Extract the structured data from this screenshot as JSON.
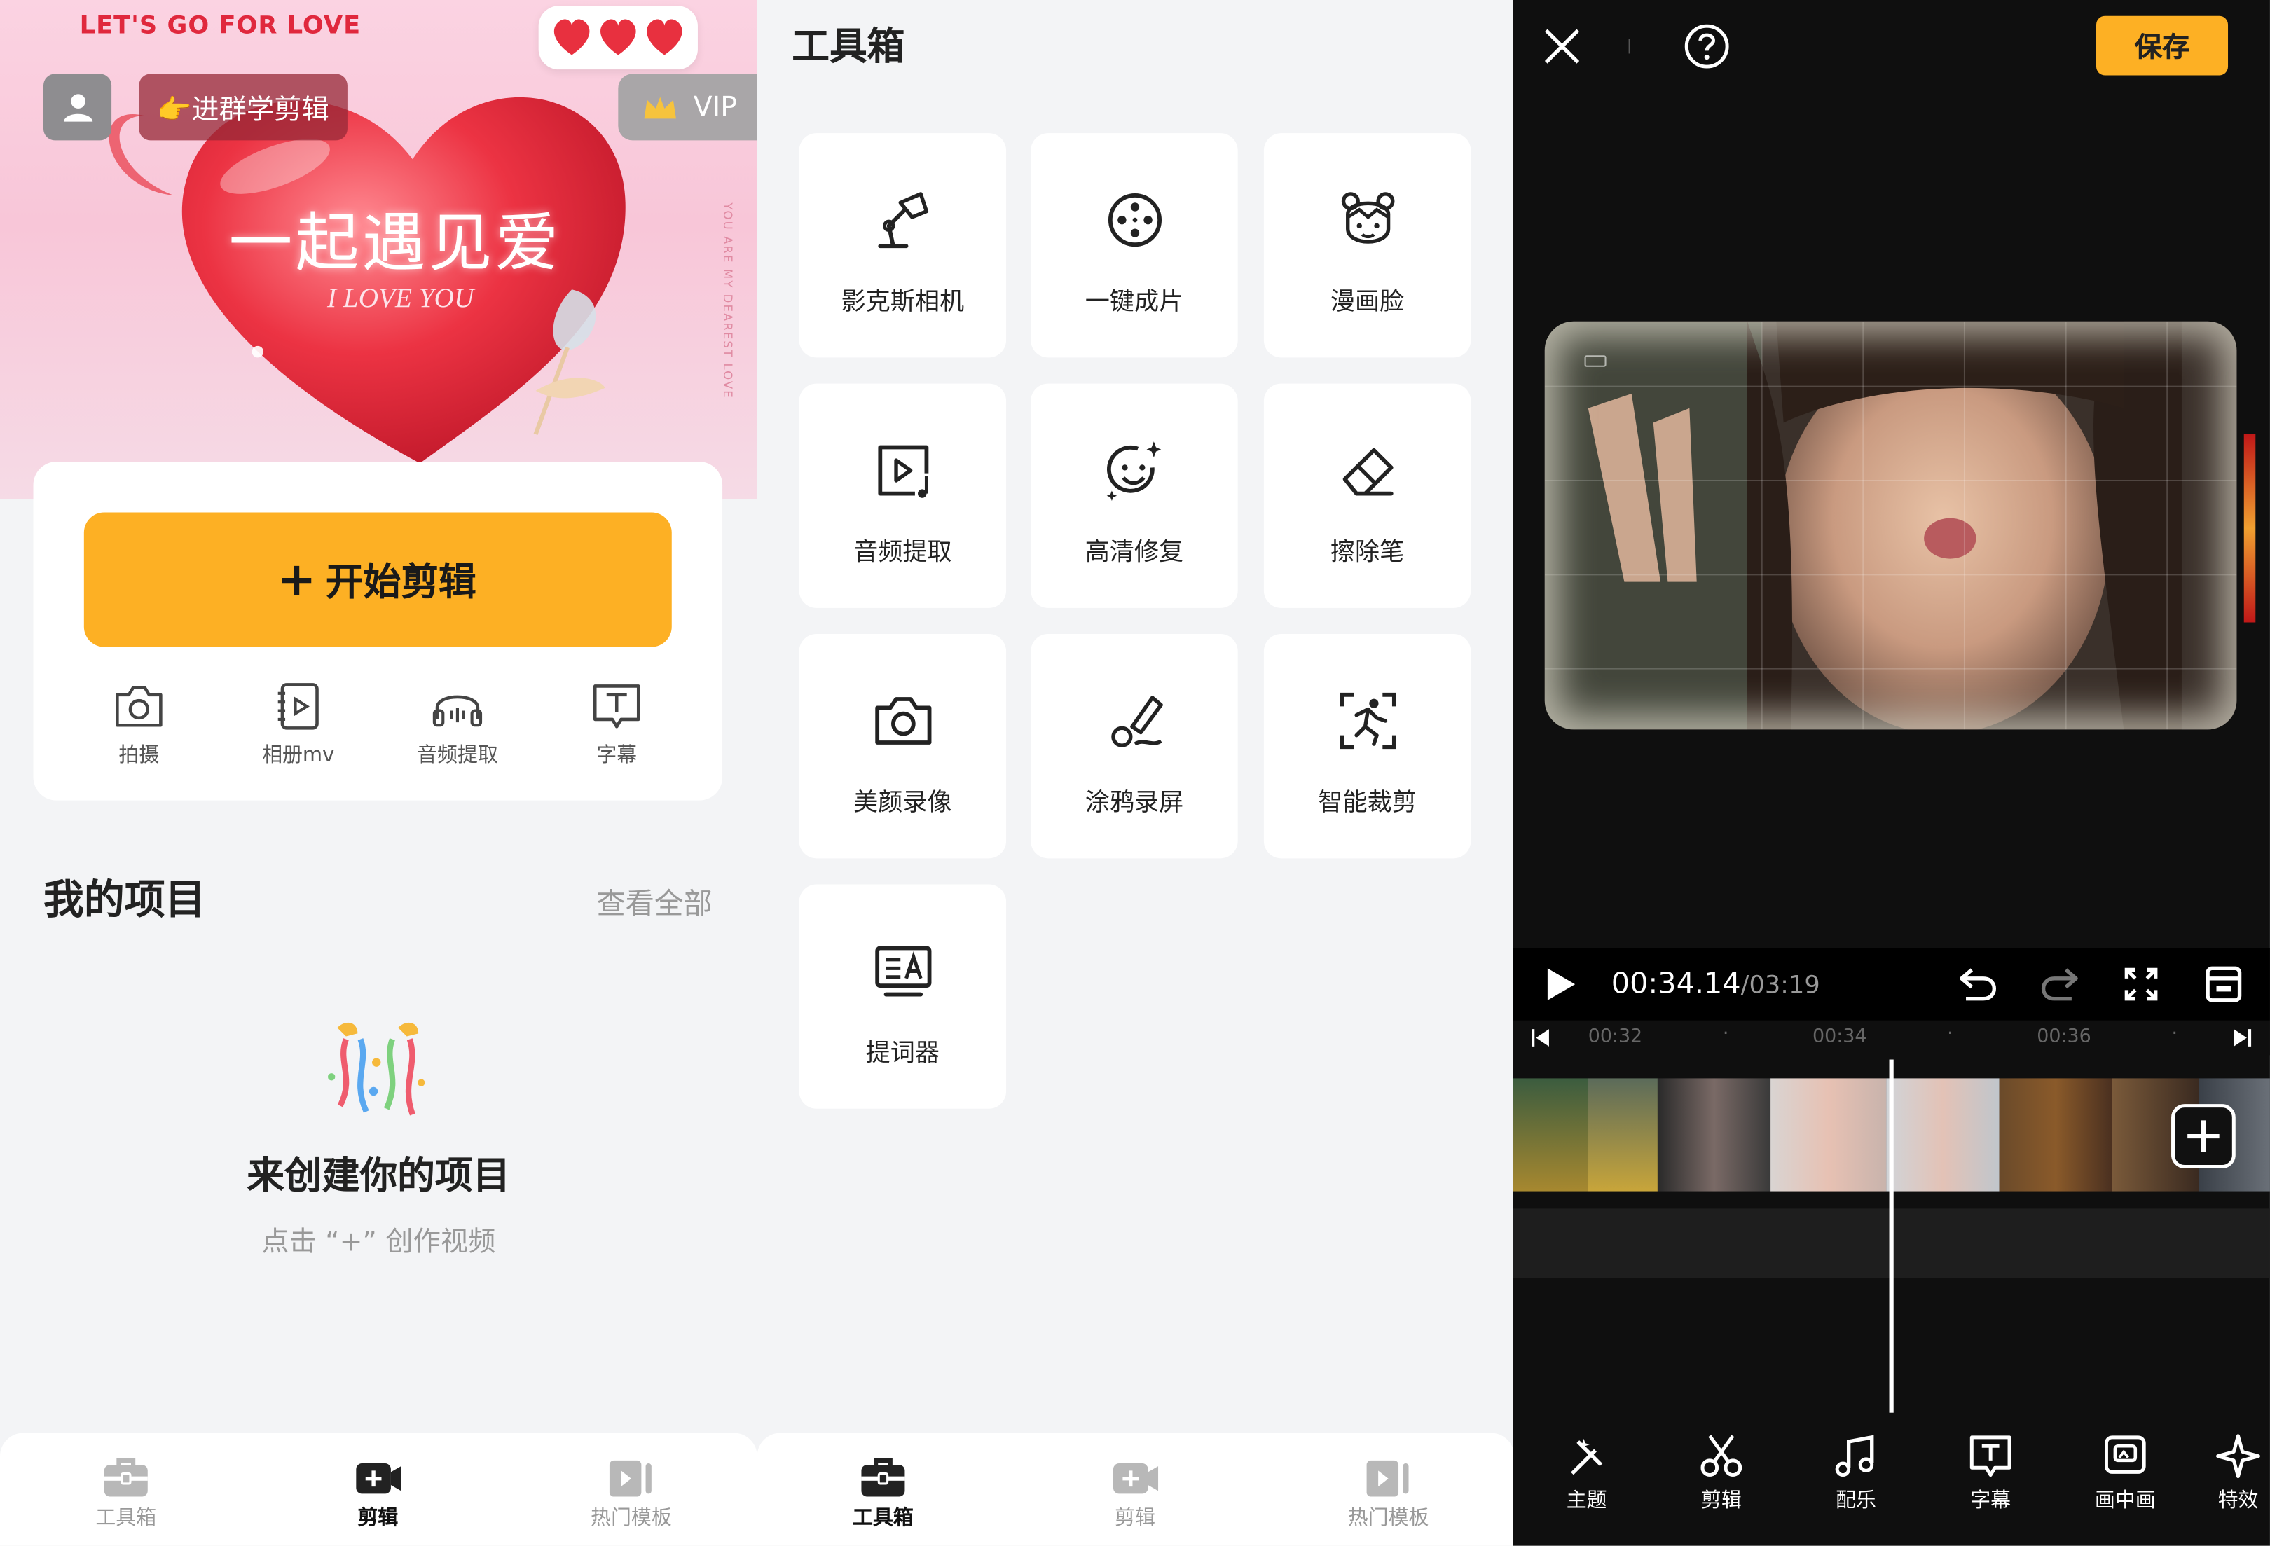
{
  "colors": {
    "accent": "#fdb024",
    "banner_pink": "#f8c6d8",
    "heart_red": "#e8303f",
    "bg": "#f3f4f6",
    "editor_bg": "#0f0f0f"
  },
  "home": {
    "banner": {
      "slogan": "LET'S GO FOR LOVE",
      "headline": "一起遇见爱",
      "sub_headline": "I LOVE YOU",
      "vertical_text": "YOU ARE MY DEAREST LOVE"
    },
    "user_icon": "user-icon",
    "group_label": "👉进群学剪辑",
    "vip_label": "VIP",
    "start_button": "开始剪辑",
    "quick_actions": [
      {
        "label": "拍摄",
        "icon": "camera-icon"
      },
      {
        "label": "相册mv",
        "icon": "album-icon"
      },
      {
        "label": "音频提取",
        "icon": "headphones-icon"
      },
      {
        "label": "字幕",
        "icon": "subtitle-icon"
      }
    ],
    "section_title": "我的项目",
    "view_all": "查看全部",
    "empty_title": "来创建你的项目",
    "empty_subtitle": "点击 “+” 创作视频",
    "tabs": [
      {
        "label": "工具箱",
        "icon": "toolbox-icon"
      },
      {
        "label": "剪辑",
        "icon": "video-icon"
      },
      {
        "label": "热门模板",
        "icon": "template-icon"
      }
    ]
  },
  "toolbox": {
    "title": "工具箱",
    "tools": [
      {
        "label": "影克斯相机",
        "icon": "desk-lamp-icon"
      },
      {
        "label": "一键成片",
        "icon": "film-reel-icon"
      },
      {
        "label": "漫画脸",
        "icon": "cartoon-face-icon"
      },
      {
        "label": "音频提取",
        "icon": "audio-extract-icon"
      },
      {
        "label": "高清修复",
        "icon": "sparkle-face-icon"
      },
      {
        "label": "擦除笔",
        "icon": "eraser-icon"
      },
      {
        "label": "美颜录像",
        "icon": "camera-icon"
      },
      {
        "label": "涂鸦录屏",
        "icon": "brush-icon"
      },
      {
        "label": "智能裁剪",
        "icon": "smart-crop-icon"
      },
      {
        "label": "提词器",
        "icon": "teleprompter-icon"
      }
    ],
    "tabs": [
      {
        "label": "工具箱",
        "icon": "toolbox-icon"
      },
      {
        "label": "剪辑",
        "icon": "video-icon"
      },
      {
        "label": "热门模板",
        "icon": "template-icon"
      }
    ]
  },
  "editor": {
    "save_label": "保存",
    "current_time": "00:34.14",
    "duration": "/03:19",
    "ruler_marks": [
      "00:32",
      "00:34",
      "00:36"
    ],
    "bottom_tools": [
      {
        "label": "主题",
        "icon": "magic-wand-icon"
      },
      {
        "label": "剪辑",
        "icon": "scissors-icon"
      },
      {
        "label": "配乐",
        "icon": "music-icon"
      },
      {
        "label": "字幕",
        "icon": "subtitle-icon"
      },
      {
        "label": "画中画",
        "icon": "picture-in-picture-icon"
      },
      {
        "label": "特效",
        "icon": "effects-icon"
      }
    ]
  }
}
